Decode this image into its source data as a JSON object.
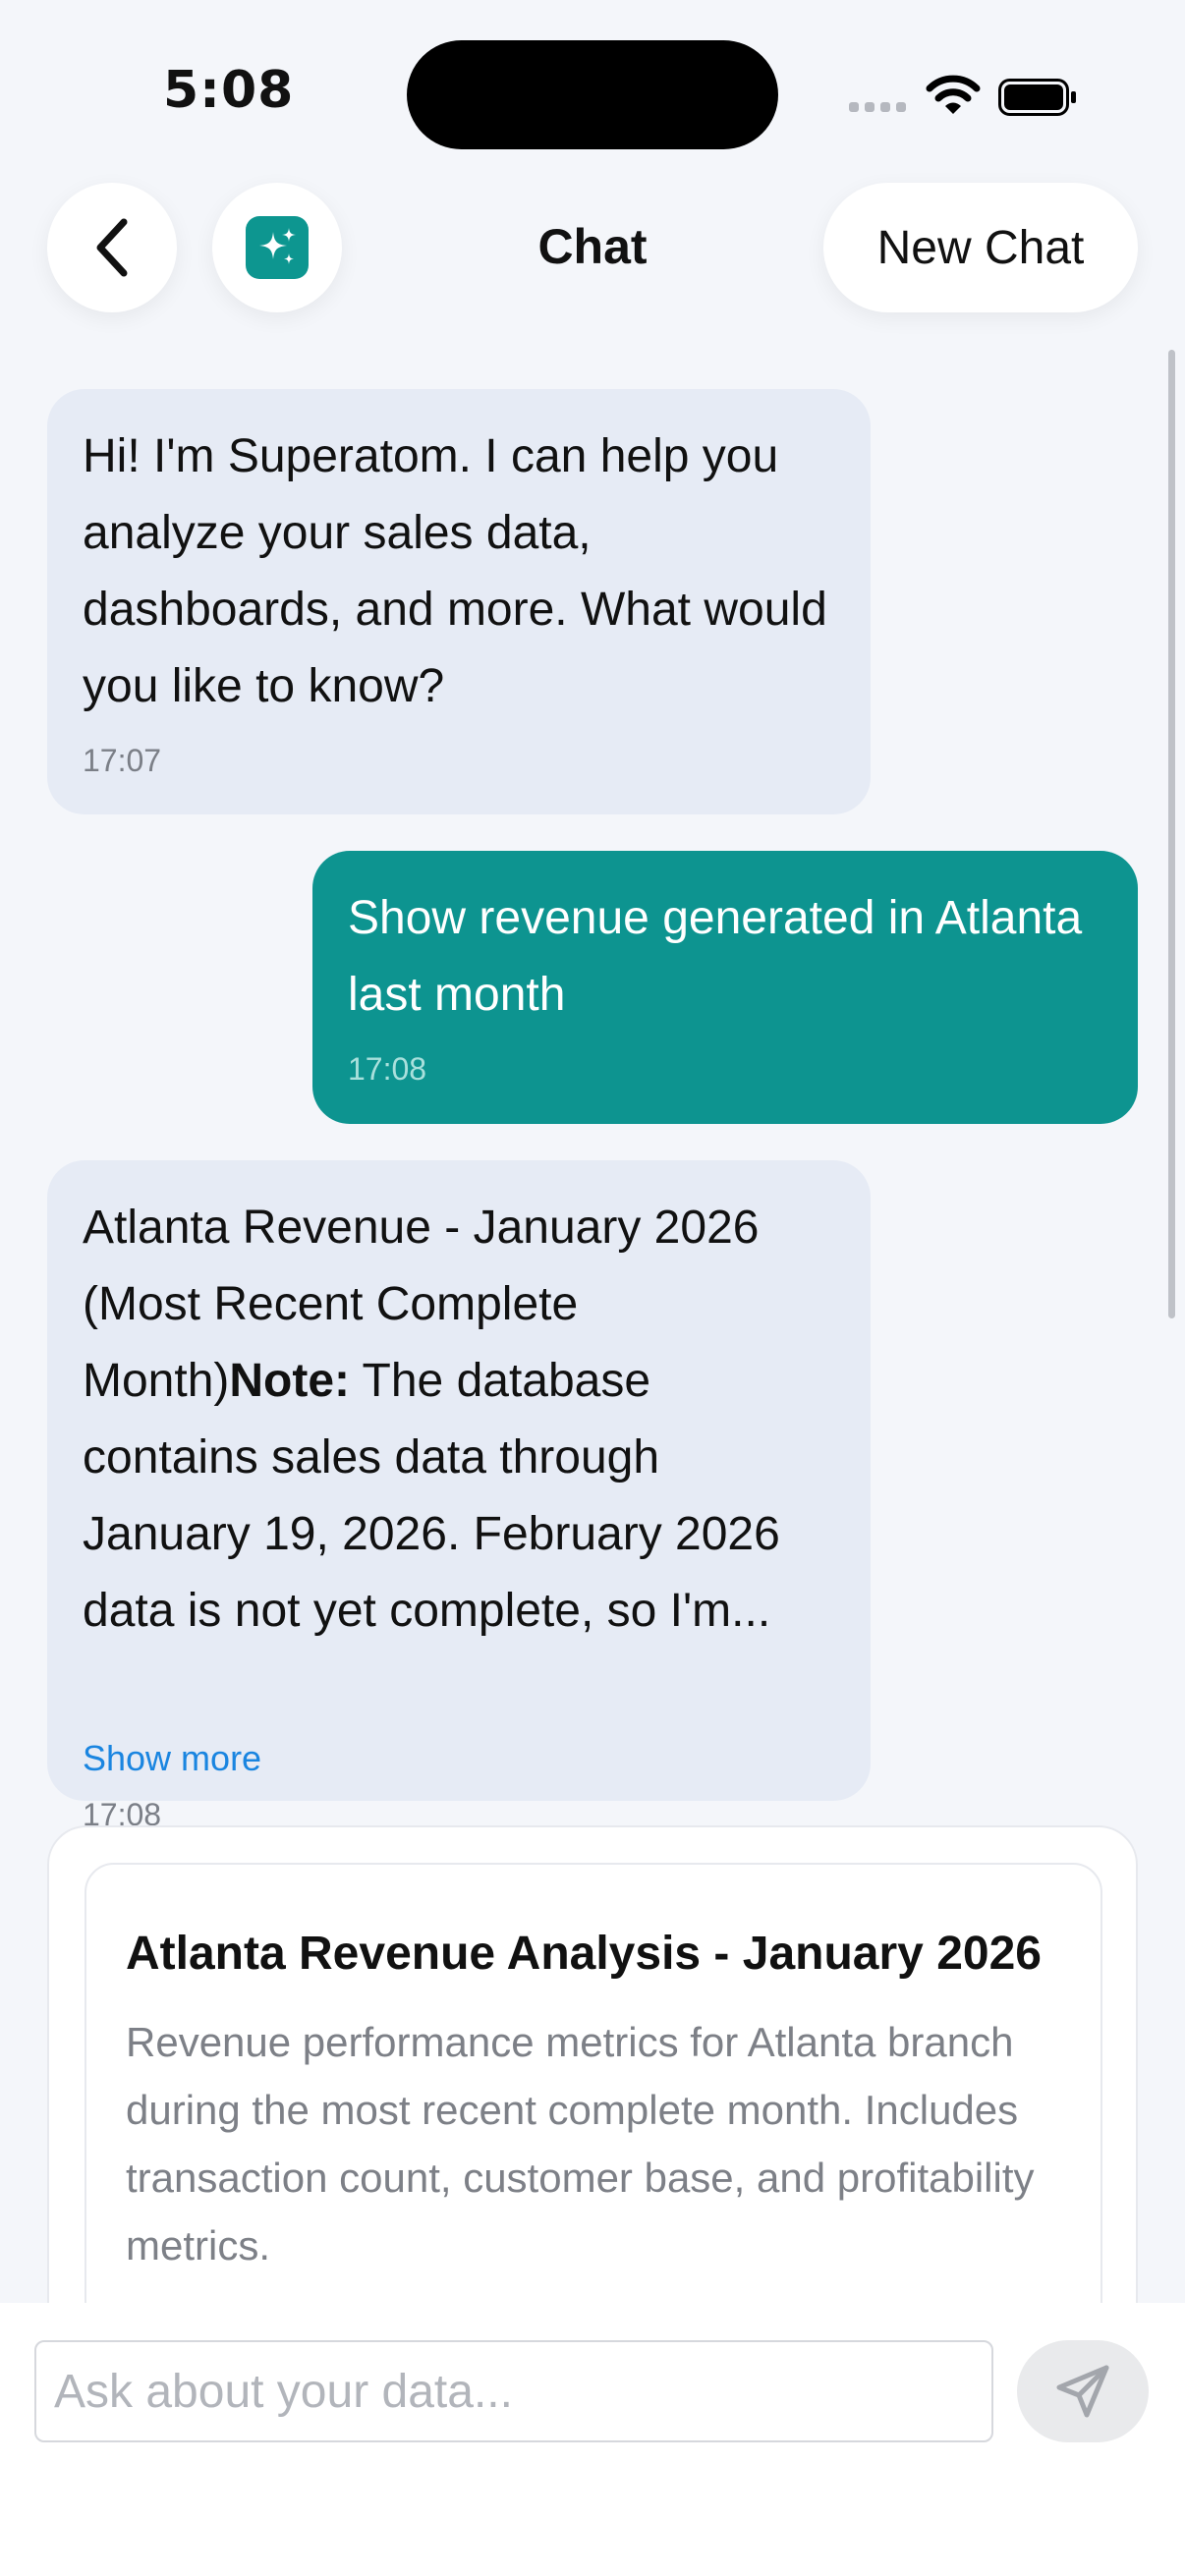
{
  "status_bar": {
    "time": "5:08"
  },
  "header": {
    "title": "Chat",
    "new_chat_label": "New Chat"
  },
  "messages": [
    {
      "sender": "assistant",
      "text": "Hi! I'm Superatom. I can help you analyze your sales data, dashboards, and more. What would you like to know?",
      "time": "17:07"
    },
    {
      "sender": "user",
      "text": "Show revenue generated in Atlanta last month",
      "time": "17:08"
    },
    {
      "sender": "assistant",
      "text_before_bold": "Atlanta Revenue - January 2026 (Most Recent Complete Month)",
      "bold": "Note:",
      "text_after_bold": " The database contains sales data through January 19, 2026. February 2026 data is not yet complete, so I'm",
      "ellipsis": "...",
      "show_more_label": "Show more",
      "time": "17:08"
    }
  ],
  "card": {
    "title": "Atlanta Revenue Analysis - January 2026",
    "description": "Revenue performance metrics for Atlanta branch during the most recent complete month. Includes transaction count, customer base, and profitability metrics."
  },
  "composer": {
    "placeholder": "Ask about your data..."
  },
  "icons": {
    "back": "chevron-left-icon",
    "app": "sparkles-icon",
    "send": "send-icon",
    "wifi": "wifi-icon",
    "battery": "battery-icon"
  },
  "colors": {
    "accent": "#0d9490",
    "assistant_bubble": "#e6ebf5",
    "link": "#1a85e0",
    "background": "#f4f6fa"
  }
}
